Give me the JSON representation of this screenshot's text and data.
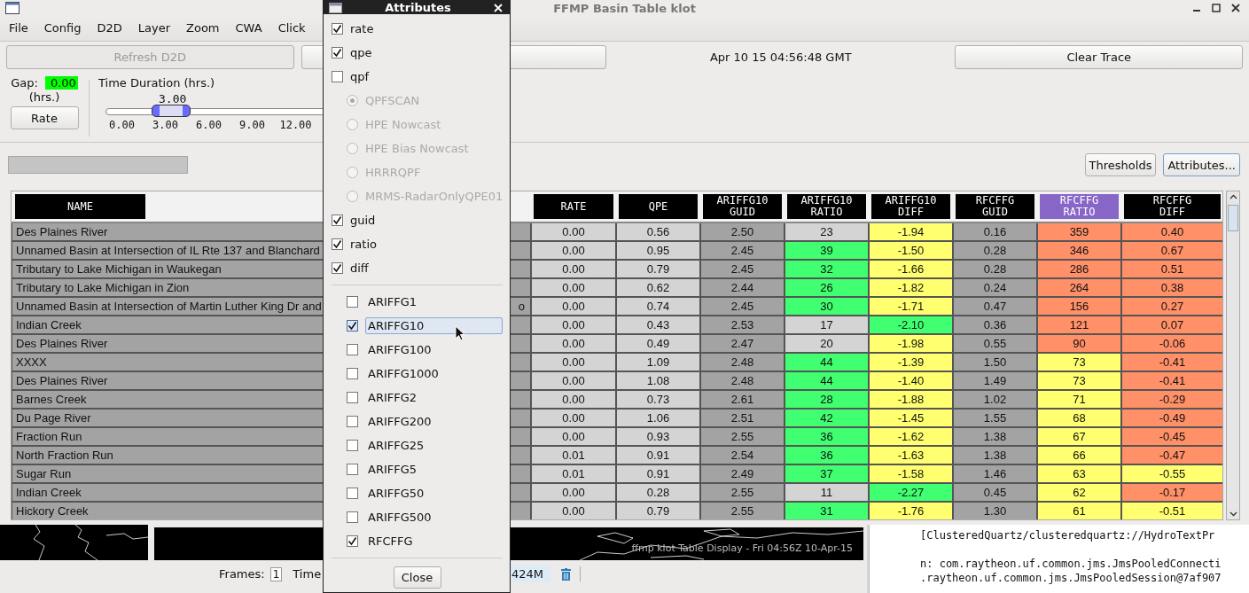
{
  "window": {
    "title": "FFMP Basin Table klot"
  },
  "menu": [
    "File",
    "Config",
    "D2D",
    "Layer",
    "Zoom",
    "CWA",
    "Click"
  ],
  "toolbar": {
    "refresh_button": {
      "label": "Refresh D2D",
      "disabled": true
    },
    "timestamp": "Apr 10 15 04:56:48 GMT",
    "clear_trace_button": "Clear Trace"
  },
  "gap": {
    "label": "Gap:",
    "value": "0.00",
    "unit": "(hrs.)",
    "rate_button": "Rate"
  },
  "time_duration": {
    "label": "Time Duration (hrs.)",
    "value": "3.00",
    "level": 0.166,
    "ticks": [
      "0.00",
      "3.00",
      "6.00",
      "9.00",
      "12.00"
    ]
  },
  "actions": {
    "progress_bar": {
      "level": 0
    },
    "thresholds_button": "Thresholds",
    "attributes_button": "Attributes..."
  },
  "table": {
    "name_header": "NAME",
    "columns": [
      {
        "label": "RATE",
        "selected": false
      },
      {
        "label": "QPE",
        "selected": false
      },
      {
        "label": "ARIFFG10\nGUID",
        "selected": false
      },
      {
        "label": "ARIFFG10\nRATIO",
        "selected": false
      },
      {
        "label": "ARIFFG10\nDIFF",
        "selected": false
      },
      {
        "label": "RFCFFG\nGUID",
        "selected": false
      },
      {
        "label": "RFCFFG\nRATIO",
        "selected": true
      },
      {
        "label": "RFCFFG\nDIFF",
        "selected": false
      }
    ],
    "rows": [
      {
        "name": "Des Plaines River",
        "cells": [
          {
            "text": "0.00",
            "color": "#d4d4d4"
          },
          {
            "text": "0.56",
            "color": "#d4d4d4"
          },
          {
            "text": "2.50",
            "color": "#a3a3a3"
          },
          {
            "text": "23",
            "color": "#d4d4d4"
          },
          {
            "text": "-1.94",
            "color": "#ffff70"
          },
          {
            "text": "0.16",
            "color": "#a3a3a3"
          },
          {
            "text": "359",
            "color": "#ff9068"
          },
          {
            "text": "0.40",
            "color": "#ff9068"
          }
        ]
      },
      {
        "name": "Unnamed Basin at Intersection of IL Rte 137 and Blanchard",
        "cells": [
          {
            "text": "0.00",
            "color": "#d4d4d4"
          },
          {
            "text": "0.95",
            "color": "#d4d4d4"
          },
          {
            "text": "2.45",
            "color": "#a3a3a3"
          },
          {
            "text": "39",
            "color": "#40ff70"
          },
          {
            "text": "-1.50",
            "color": "#ffff70"
          },
          {
            "text": "0.28",
            "color": "#a3a3a3"
          },
          {
            "text": "346",
            "color": "#ff9068"
          },
          {
            "text": "0.67",
            "color": "#ff9068"
          }
        ]
      },
      {
        "name": "Tributary to Lake Michigan in Waukegan",
        "cells": [
          {
            "text": "0.00",
            "color": "#d4d4d4"
          },
          {
            "text": "0.79",
            "color": "#d4d4d4"
          },
          {
            "text": "2.45",
            "color": "#a3a3a3"
          },
          {
            "text": "32",
            "color": "#40ff70"
          },
          {
            "text": "-1.66",
            "color": "#ffff70"
          },
          {
            "text": "0.28",
            "color": "#a3a3a3"
          },
          {
            "text": "286",
            "color": "#ff9068"
          },
          {
            "text": "0.51",
            "color": "#ff9068"
          }
        ]
      },
      {
        "name": "Tributary to Lake Michigan in Zion",
        "cells": [
          {
            "text": "0.00",
            "color": "#d4d4d4"
          },
          {
            "text": "0.62",
            "color": "#d4d4d4"
          },
          {
            "text": "2.44",
            "color": "#a3a3a3"
          },
          {
            "text": "26",
            "color": "#40ff70"
          },
          {
            "text": "-1.82",
            "color": "#ffff70"
          },
          {
            "text": "0.24",
            "color": "#a3a3a3"
          },
          {
            "text": "264",
            "color": "#ff9068"
          },
          {
            "text": "0.38",
            "color": "#ff9068"
          }
        ]
      },
      {
        "name": "Unnamed Basin at Intersection of Martin Luther King Dr and",
        "name_end": "o",
        "cells": [
          {
            "text": "0.00",
            "color": "#d4d4d4"
          },
          {
            "text": "0.74",
            "color": "#d4d4d4"
          },
          {
            "text": "2.45",
            "color": "#a3a3a3"
          },
          {
            "text": "30",
            "color": "#40ff70"
          },
          {
            "text": "-1.71",
            "color": "#ffff70"
          },
          {
            "text": "0.47",
            "color": "#a3a3a3"
          },
          {
            "text": "156",
            "color": "#ff9068"
          },
          {
            "text": "0.27",
            "color": "#ff9068"
          }
        ]
      },
      {
        "name": "Indian Creek",
        "cells": [
          {
            "text": "0.00",
            "color": "#d4d4d4"
          },
          {
            "text": "0.43",
            "color": "#d4d4d4"
          },
          {
            "text": "2.53",
            "color": "#a3a3a3"
          },
          {
            "text": "17",
            "color": "#d4d4d4"
          },
          {
            "text": "-2.10",
            "color": "#40ff70"
          },
          {
            "text": "0.36",
            "color": "#a3a3a3"
          },
          {
            "text": "121",
            "color": "#ff9068"
          },
          {
            "text": "0.07",
            "color": "#ff9068"
          }
        ]
      },
      {
        "name": "Des Plaines River",
        "cells": [
          {
            "text": "0.00",
            "color": "#d4d4d4"
          },
          {
            "text": "0.49",
            "color": "#d4d4d4"
          },
          {
            "text": "2.47",
            "color": "#a3a3a3"
          },
          {
            "text": "20",
            "color": "#d4d4d4"
          },
          {
            "text": "-1.98",
            "color": "#ffff70"
          },
          {
            "text": "0.55",
            "color": "#a3a3a3"
          },
          {
            "text": "90",
            "color": "#ff9068"
          },
          {
            "text": "-0.06",
            "color": "#ff9068"
          }
        ]
      },
      {
        "name": "XXXX",
        "cells": [
          {
            "text": "0.00",
            "color": "#d4d4d4"
          },
          {
            "text": "1.09",
            "color": "#d4d4d4"
          },
          {
            "text": "2.48",
            "color": "#a3a3a3"
          },
          {
            "text": "44",
            "color": "#40ff70"
          },
          {
            "text": "-1.39",
            "color": "#ffff70"
          },
          {
            "text": "1.50",
            "color": "#a3a3a3"
          },
          {
            "text": "73",
            "color": "#ffff70"
          },
          {
            "text": "-0.41",
            "color": "#ff9068"
          }
        ]
      },
      {
        "name": "Des Plaines River",
        "cells": [
          {
            "text": "0.00",
            "color": "#d4d4d4"
          },
          {
            "text": "1.08",
            "color": "#d4d4d4"
          },
          {
            "text": "2.48",
            "color": "#a3a3a3"
          },
          {
            "text": "44",
            "color": "#40ff70"
          },
          {
            "text": "-1.40",
            "color": "#ffff70"
          },
          {
            "text": "1.49",
            "color": "#a3a3a3"
          },
          {
            "text": "73",
            "color": "#ffff70"
          },
          {
            "text": "-0.41",
            "color": "#ff9068"
          }
        ]
      },
      {
        "name": "Barnes Creek",
        "cells": [
          {
            "text": "0.00",
            "color": "#d4d4d4"
          },
          {
            "text": "0.73",
            "color": "#d4d4d4"
          },
          {
            "text": "2.61",
            "color": "#a3a3a3"
          },
          {
            "text": "28",
            "color": "#40ff70"
          },
          {
            "text": "-1.88",
            "color": "#ffff70"
          },
          {
            "text": "1.02",
            "color": "#a3a3a3"
          },
          {
            "text": "71",
            "color": "#ffff70"
          },
          {
            "text": "-0.29",
            "color": "#ff9068"
          }
        ]
      },
      {
        "name": "Du Page River",
        "cells": [
          {
            "text": "0.00",
            "color": "#d4d4d4"
          },
          {
            "text": "1.06",
            "color": "#d4d4d4"
          },
          {
            "text": "2.51",
            "color": "#a3a3a3"
          },
          {
            "text": "42",
            "color": "#40ff70"
          },
          {
            "text": "-1.45",
            "color": "#ffff70"
          },
          {
            "text": "1.55",
            "color": "#a3a3a3"
          },
          {
            "text": "68",
            "color": "#ffff70"
          },
          {
            "text": "-0.49",
            "color": "#ff9068"
          }
        ]
      },
      {
        "name": "Fraction Run",
        "cells": [
          {
            "text": "0.00",
            "color": "#d4d4d4"
          },
          {
            "text": "0.93",
            "color": "#d4d4d4"
          },
          {
            "text": "2.55",
            "color": "#a3a3a3"
          },
          {
            "text": "36",
            "color": "#40ff70"
          },
          {
            "text": "-1.62",
            "color": "#ffff70"
          },
          {
            "text": "1.38",
            "color": "#a3a3a3"
          },
          {
            "text": "67",
            "color": "#ffff70"
          },
          {
            "text": "-0.45",
            "color": "#ff9068"
          }
        ]
      },
      {
        "name": "North Fraction Run",
        "cells": [
          {
            "text": "0.01",
            "color": "#d4d4d4"
          },
          {
            "text": "0.91",
            "color": "#d4d4d4"
          },
          {
            "text": "2.54",
            "color": "#a3a3a3"
          },
          {
            "text": "36",
            "color": "#40ff70"
          },
          {
            "text": "-1.63",
            "color": "#ffff70"
          },
          {
            "text": "1.38",
            "color": "#a3a3a3"
          },
          {
            "text": "66",
            "color": "#ffff70"
          },
          {
            "text": "-0.47",
            "color": "#ff9068"
          }
        ]
      },
      {
        "name": "Sugar Run",
        "cells": [
          {
            "text": "0.01",
            "color": "#d4d4d4"
          },
          {
            "text": "0.91",
            "color": "#d4d4d4"
          },
          {
            "text": "2.49",
            "color": "#a3a3a3"
          },
          {
            "text": "37",
            "color": "#40ff70"
          },
          {
            "text": "-1.58",
            "color": "#ffff70"
          },
          {
            "text": "1.46",
            "color": "#a3a3a3"
          },
          {
            "text": "63",
            "color": "#ffff70"
          },
          {
            "text": "-0.55",
            "color": "#ffff70"
          }
        ]
      },
      {
        "name": "Indian Creek",
        "cells": [
          {
            "text": "0.00",
            "color": "#d4d4d4"
          },
          {
            "text": "0.28",
            "color": "#d4d4d4"
          },
          {
            "text": "2.55",
            "color": "#a3a3a3"
          },
          {
            "text": "11",
            "color": "#d4d4d4"
          },
          {
            "text": "-2.27",
            "color": "#40ff70"
          },
          {
            "text": "0.45",
            "color": "#a3a3a3"
          },
          {
            "text": "62",
            "color": "#ffff70"
          },
          {
            "text": "-0.17",
            "color": "#ff9068"
          }
        ]
      },
      {
        "name": "Hickory Creek",
        "cells": [
          {
            "text": "0.00",
            "color": "#d4d4d4"
          },
          {
            "text": "0.79",
            "color": "#d4d4d4"
          },
          {
            "text": "2.55",
            "color": "#a3a3a3"
          },
          {
            "text": "31",
            "color": "#40ff70"
          },
          {
            "text": "-1.76",
            "color": "#ffff70"
          },
          {
            "text": "1.30",
            "color": "#a3a3a3"
          },
          {
            "text": "61",
            "color": "#ffff70"
          },
          {
            "text": "-0.51",
            "color": "#ffff70"
          }
        ]
      }
    ]
  },
  "attributes_dialog": {
    "title": "Attributes",
    "options": [
      {
        "kind": "checkbox",
        "label": "rate",
        "checked": true
      },
      {
        "kind": "checkbox",
        "label": "qpe",
        "checked": true
      },
      {
        "kind": "checkbox",
        "label": "qpf",
        "checked": false
      },
      {
        "kind": "radio",
        "label": "QPFSCAN",
        "selected": true,
        "disabled": true
      },
      {
        "kind": "radio",
        "label": "HPE Nowcast",
        "selected": false,
        "disabled": true
      },
      {
        "kind": "radio",
        "label": "HPE Bias Nowcast",
        "selected": false,
        "disabled": true
      },
      {
        "kind": "radio",
        "label": "HRRRQPF",
        "selected": false,
        "disabled": true
      },
      {
        "kind": "radio",
        "label": "MRMS-RadarOnlyQPE01",
        "selected": false,
        "disabled": true
      },
      {
        "kind": "checkbox",
        "label": "guid",
        "checked": true
      },
      {
        "kind": "checkbox",
        "label": "ratio",
        "checked": true
      },
      {
        "kind": "checkbox",
        "label": "diff",
        "checked": true
      }
    ],
    "sources": [
      {
        "label": "ARIFFG1",
        "checked": false,
        "focused": false
      },
      {
        "label": "ARIFFG10",
        "checked": true,
        "focused": true
      },
      {
        "label": "ARIFFG100",
        "checked": false,
        "focused": false
      },
      {
        "label": "ARIFFG1000",
        "checked": false,
        "focused": false
      },
      {
        "label": "ARIFFG2",
        "checked": false,
        "focused": false
      },
      {
        "label": "ARIFFG200",
        "checked": false,
        "focused": false
      },
      {
        "label": "ARIFFG25",
        "checked": false,
        "focused": false
      },
      {
        "label": "ARIFFG5",
        "checked": false,
        "focused": false
      },
      {
        "label": "ARIFFG50",
        "checked": false,
        "focused": false
      },
      {
        "label": "ARIFFG500",
        "checked": false,
        "focused": false
      },
      {
        "label": "RFCFFG",
        "checked": true,
        "focused": false
      }
    ],
    "close_button": "Close"
  },
  "d2d": {
    "overlay_text": "ffmp klot Table Display - Fri 04:56Z 10-Apr-15",
    "frames_label": "Frames:",
    "frames_value": "1",
    "time_label": "Time",
    "memory": "424M"
  },
  "console": {
    "lines": [
      "[ClusteredQuartz/clusteredquartz://HydroTextPr",
      "n: com.raytheon.uf.common.jms.JmsPooledConnecti",
      ".raytheon.uf.common.jms.JmsPooledSession@7af907"
    ]
  }
}
